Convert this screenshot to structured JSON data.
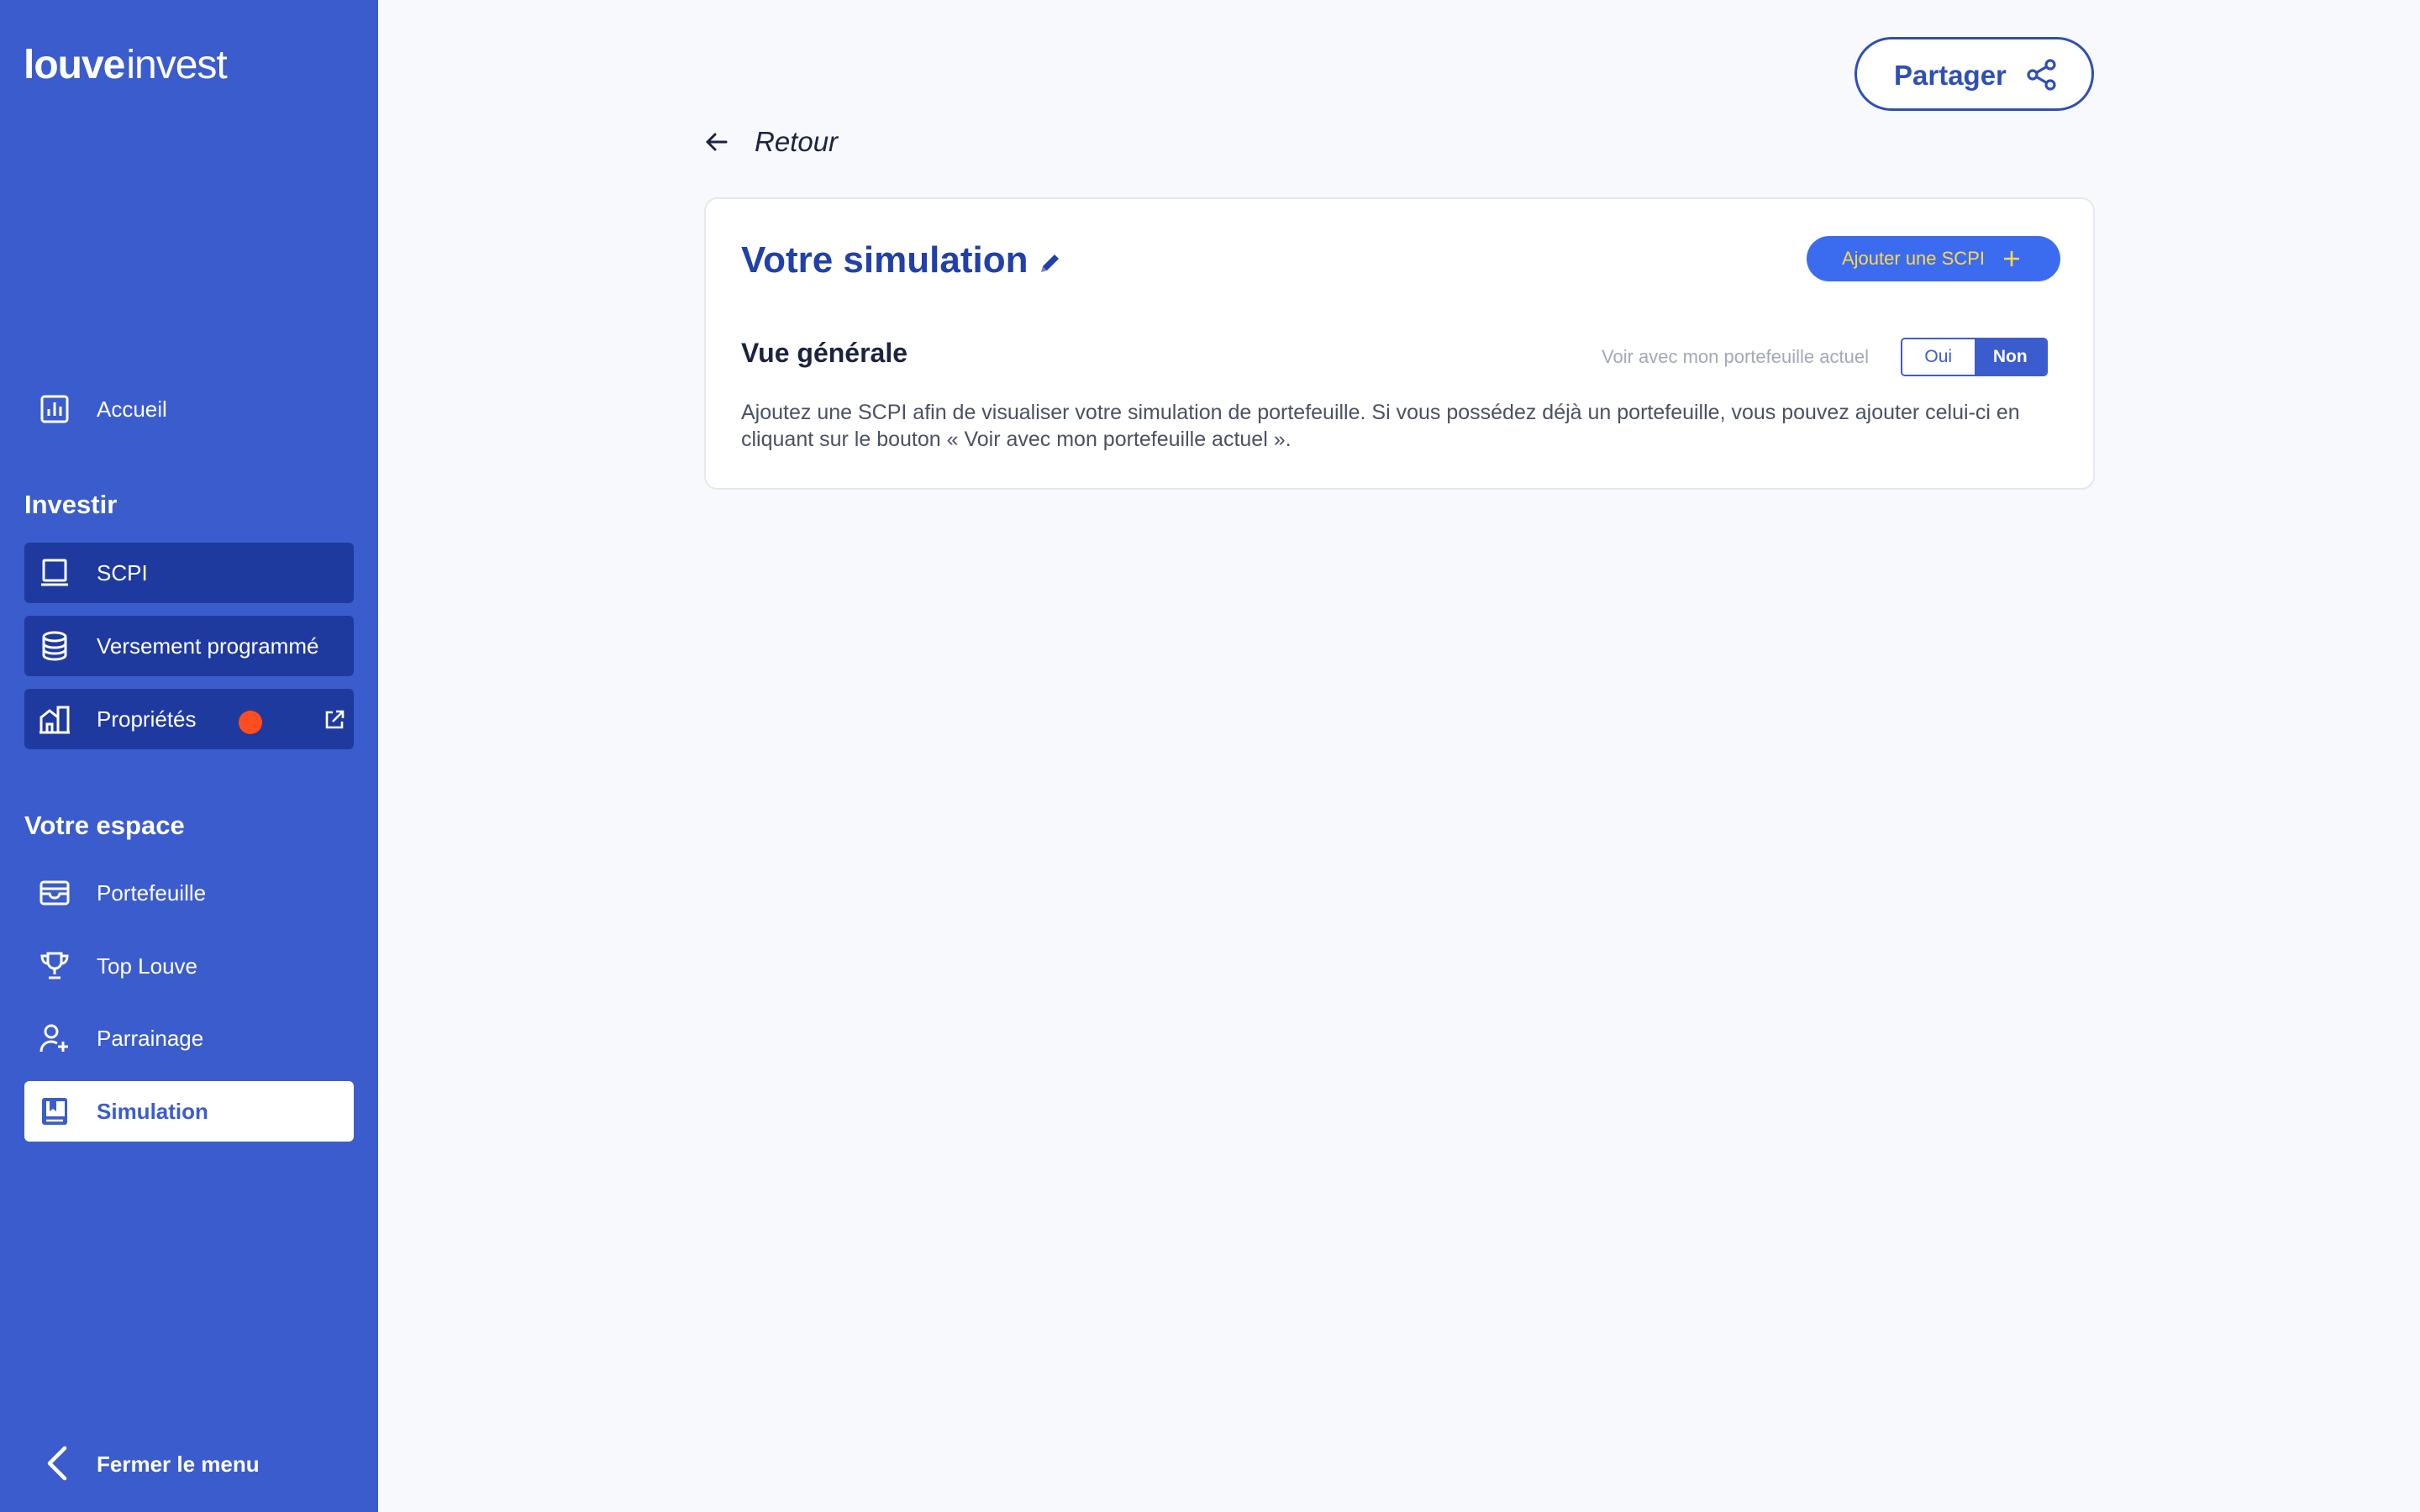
{
  "brand": {
    "bold": "louve",
    "light": "invest"
  },
  "sidebar": {
    "home": "Accueil",
    "invest_heading": "Investir",
    "invest_items": [
      {
        "label": "SCPI"
      },
      {
        "label": "Versement programmé"
      },
      {
        "label": "Propriétés"
      }
    ],
    "space_heading": "Votre espace",
    "space_items": [
      {
        "label": "Portefeuille"
      },
      {
        "label": "Top Louve"
      },
      {
        "label": "Parrainage"
      },
      {
        "label": "Simulation"
      }
    ],
    "close_menu": "Fermer le menu"
  },
  "header": {
    "share": "Partager"
  },
  "back": {
    "label": "Retour"
  },
  "card": {
    "title": "Votre simulation",
    "add_button": "Ajouter une SCPI",
    "subtitle": "Vue générale",
    "toggle_label": "Voir avec mon portefeuille actuel",
    "toggle_yes": "Oui",
    "toggle_no": "Non",
    "description": "Ajoutez une SCPI afin de visualiser votre simulation de portefeuille. Si vous possédez déjà un portefeuille, vous pouvez ajouter celui-ci en cliquant sur le bouton « Voir avec mon portefeuille actuel »."
  },
  "colors": {
    "sidebar": "#3b5ccc",
    "sidebar_dark": "#1f3a9e",
    "accent": "#2140a8",
    "add_button": "#3b6cf0",
    "notification_dot": "#ff4d1f"
  }
}
